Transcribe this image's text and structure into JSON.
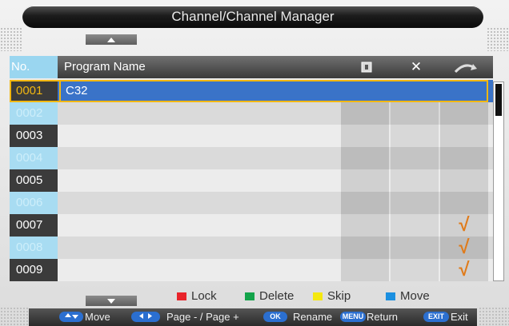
{
  "title": "Channel/Channel Manager",
  "columns": {
    "no": "No.",
    "name": "Program Name",
    "lock_icon": "lock-icon",
    "delete_icon": "delete-icon",
    "skip_icon": "skip-icon",
    "delete_glyph": "✕"
  },
  "rows": [
    {
      "no": "0001",
      "name": "C32",
      "selected": true,
      "skip": false
    },
    {
      "no": "0002",
      "name": "",
      "selected": false,
      "skip": false
    },
    {
      "no": "0003",
      "name": "",
      "selected": false,
      "skip": false
    },
    {
      "no": "0004",
      "name": "",
      "selected": false,
      "skip": false
    },
    {
      "no": "0005",
      "name": "",
      "selected": false,
      "skip": false
    },
    {
      "no": "0006",
      "name": "",
      "selected": false,
      "skip": false
    },
    {
      "no": "0007",
      "name": "",
      "selected": false,
      "skip": true
    },
    {
      "no": "0008",
      "name": "",
      "selected": false,
      "skip": true
    },
    {
      "no": "0009",
      "name": "",
      "selected": false,
      "skip": true
    }
  ],
  "skip_mark": "√",
  "legend": {
    "lock": "Lock",
    "delete": "Delete",
    "skip": "Skip",
    "move": "Move"
  },
  "legend_colors": {
    "lock": "#e8232a",
    "delete": "#13a34a",
    "skip": "#f5e80f",
    "move": "#1b8fe0"
  },
  "footer": {
    "move": "Move",
    "page": "Page - / Page +",
    "ok_key": "OK",
    "rename": "Rename",
    "menu_key": "MENU",
    "return": "Return",
    "exit_key": "EXIT",
    "exit": "Exit"
  },
  "colors": {
    "selected_bg": "#3a73c8",
    "selected_border": "#f2b711",
    "no_odd_bg": "#3b3b3b",
    "no_even_bg": "#a8dcf2",
    "no_odd_text": "#ffffff",
    "no_even_text": "#cdeefa",
    "skip_check": "#e07b1a"
  }
}
